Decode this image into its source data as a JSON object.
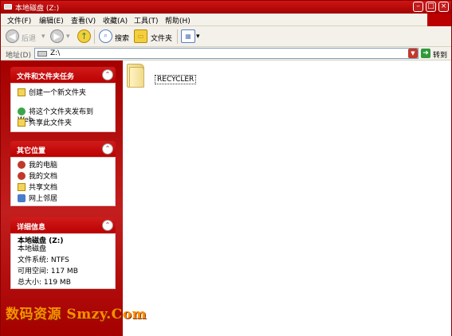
{
  "window": {
    "title": "本地磁盘 (Z:)",
    "controls": [
      "minimize",
      "maximize",
      "close"
    ]
  },
  "menubar": {
    "items": [
      "文件(F)",
      "编辑(E)",
      "查看(V)",
      "收藏(A)",
      "工具(T)",
      "帮助(H)"
    ]
  },
  "toolbar": {
    "back_label": "后退",
    "search_label": "搜索",
    "folders_label": "文件夹"
  },
  "address": {
    "label": "地址(D)",
    "value": "Z:\\",
    "go_label": "转到"
  },
  "tasks_panel": {
    "title": "文件和文件夹任务",
    "items": [
      "创建一个新文件夹",
      "将这个文件夹发布到\nWeb",
      "共享此文件夹"
    ]
  },
  "other_places_panel": {
    "title": "其它位置",
    "items": [
      "我的电脑",
      "我的文档",
      "共享文档",
      "网上邻居"
    ]
  },
  "details_panel": {
    "title": "详细信息",
    "name": "本地磁盘 (Z:)",
    "type": "本地磁盘",
    "filesystem": "文件系统: NTFS",
    "free_space": "可用空间: 117 MB",
    "total_size": "总大小: 119 MB"
  },
  "content": {
    "items": [
      {
        "name": "RECYCLER",
        "icon": "folder-icon"
      }
    ]
  },
  "watermark": "数码资源 Smzy.Com",
  "colors": {
    "theme_red": "#b00000",
    "go_green": "#2e9a3a",
    "watermark_orange": "#ff8c00"
  }
}
